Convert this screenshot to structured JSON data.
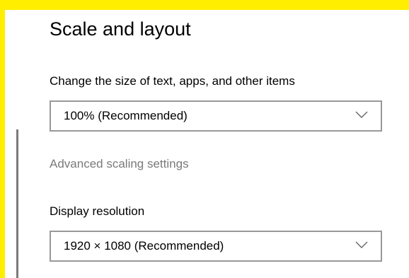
{
  "section": {
    "title": "Scale and layout"
  },
  "scale": {
    "label": "Change the size of text, apps, and other items",
    "selected": "100% (Recommended)"
  },
  "advanced": {
    "link_label": "Advanced scaling settings"
  },
  "resolution": {
    "label": "Display resolution",
    "selected": "1920 × 1080 (Recommended)"
  },
  "icons": {
    "dropdown_chevron": "chevron-down-icon"
  },
  "colors": {
    "frame": "#ffee00",
    "muted_text": "#7a7a7a",
    "dropdown_border": "#999999"
  }
}
